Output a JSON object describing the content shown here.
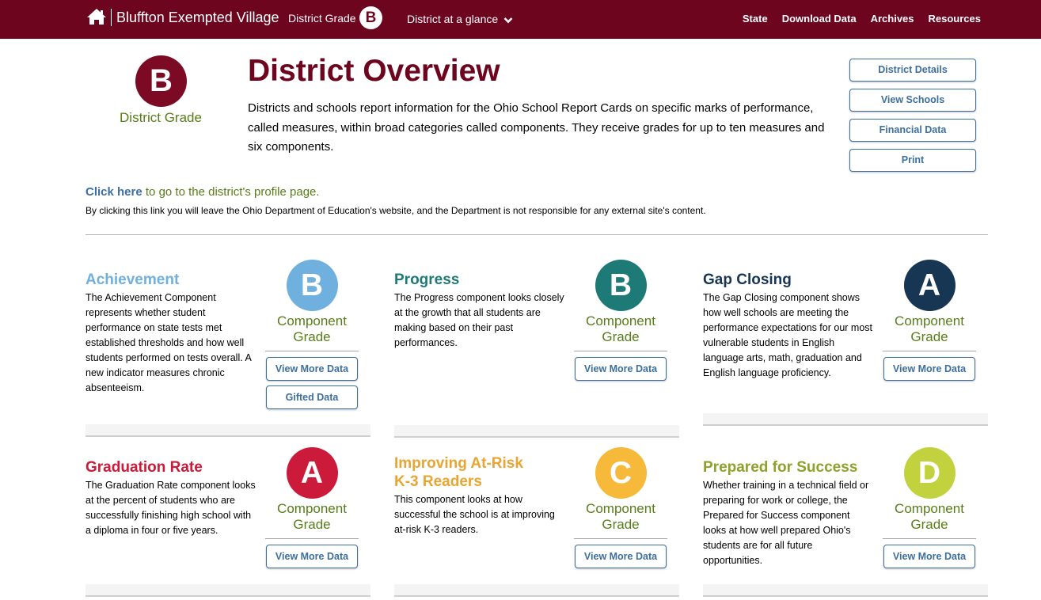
{
  "header": {
    "home_icon": "home-icon",
    "district_name": "Bluffton Exempted Village",
    "district_grade_label": "District Grade",
    "district_grade": "B",
    "glance_menu": "District at a glance",
    "nav_links": [
      "State",
      "Download Data",
      "Archives",
      "Resources"
    ],
    "bar_color": "#6e051e"
  },
  "overview": {
    "grade": "B",
    "grade_label": "District Grade",
    "title": "District Overview",
    "intro": "Districts and schools report information for the Ohio School Report Cards on specific marks of performance, called measures, within broad categories called components. They receive grades for up to ten measures and six components.",
    "buttons": [
      "District Details",
      "View Schools",
      "Financial Data",
      "Print"
    ],
    "profile_link": "Click here",
    "profile_text": " to go to the district's profile page.",
    "disclaimer": "By clicking this link you will leave the Ohio Department of Education's website, and the Department is not responsible for any external site's content."
  },
  "components": [
    {
      "title": "Achievement",
      "color": "#6fb0df",
      "grade": "B",
      "description": "The Achievement Component represents whether student performance on state tests met established thresholds and how well students performed on tests overall. A new indicator measures chronic absenteeism.",
      "grade_label_1": "Component",
      "grade_label_2": "Grade",
      "buttons": [
        "View More Data",
        "Gifted Data"
      ]
    },
    {
      "title": "Progress",
      "color": "#1d7a77",
      "grade": "B",
      "description": "The Progress component looks closely at the growth that all students are making based on their past performances.",
      "grade_label_1": "Component",
      "grade_label_2": "Grade",
      "buttons": [
        "View More Data"
      ]
    },
    {
      "title": "Gap Closing",
      "color": "#173654",
      "grade": "A",
      "description": "The Gap Closing component shows how well schools are meeting the performance expectations for our most vulnerable students in English language arts, math, graduation and English language proficiency.",
      "grade_label_1": "Component",
      "grade_label_2": "Grade",
      "buttons": [
        "View More Data"
      ]
    },
    {
      "title": "Graduation Rate",
      "color": "#cc1a3a",
      "grade": "A",
      "description": "The Graduation Rate component looks at the percent of students who are successfully finishing high school with a diploma in four or five years.",
      "grade_label_1": "Component",
      "grade_label_2": "Grade",
      "buttons": [
        "View More Data"
      ]
    },
    {
      "title_line1": "Improving At-Risk",
      "title_line2": "K-3 Readers",
      "color": "#f6b93a",
      "title_color": "#e8a532",
      "grade": "C",
      "description": "This component looks at how successful the school is at improving at-risk K-3 readers.",
      "grade_label_1": "Component",
      "grade_label_2": "Grade",
      "buttons": [
        "View More Data"
      ]
    },
    {
      "title": "Prepared for Success",
      "color": "#c2d23e",
      "title_color": "#8ea22a",
      "grade": "D",
      "description": "Whether training in a technical field or preparing for work or college, the Prepared for Success component looks at how well prepared Ohio's students are for all future opportunities.",
      "grade_label_1": "Component",
      "grade_label_2": "Grade",
      "buttons": [
        "View More Data"
      ]
    }
  ]
}
